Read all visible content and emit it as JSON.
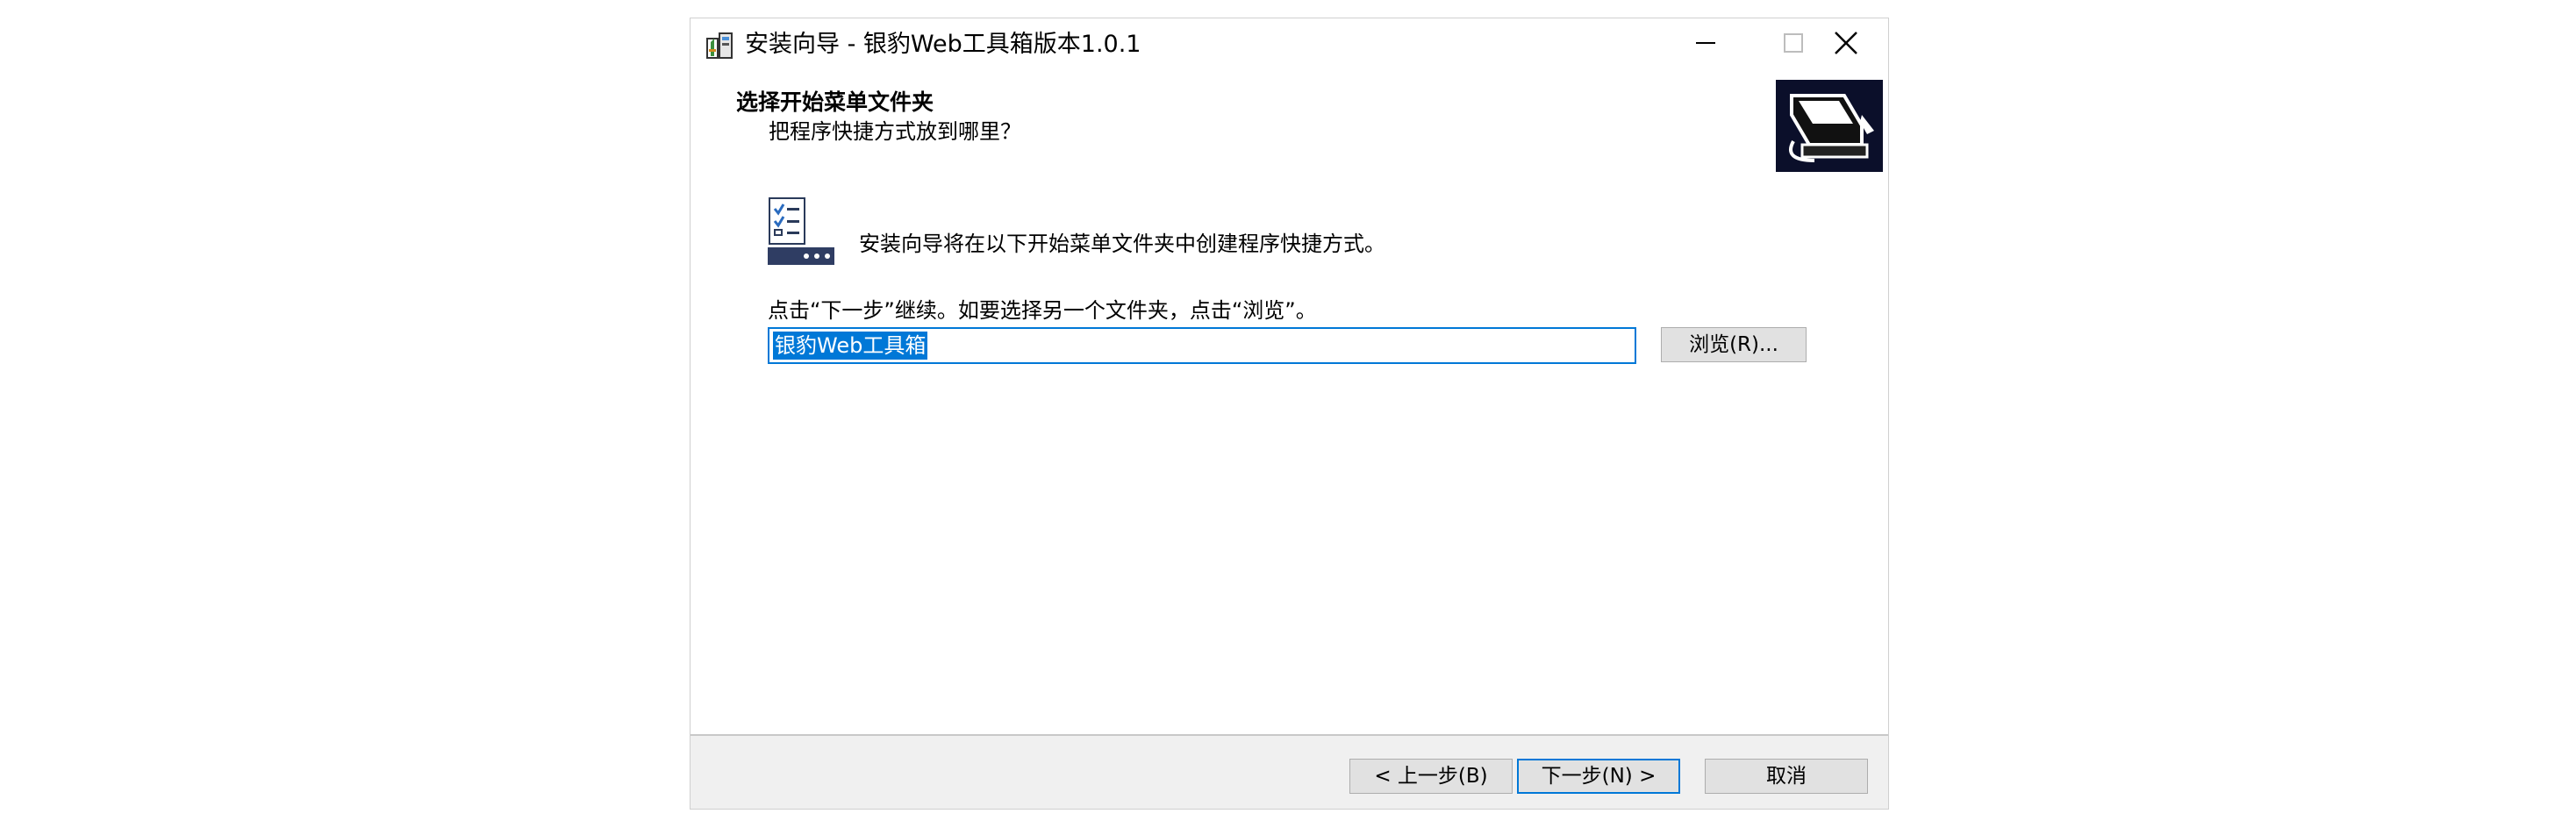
{
  "window": {
    "title": "安装向导 - 银豹Web工具箱版本1.0.1",
    "icon": "installer-icon",
    "controls": [
      "minimize-icon",
      "maximize-icon",
      "close-icon"
    ]
  },
  "header": {
    "title": "选择开始菜单文件夹",
    "subtitle": "把程序快捷方式放到哪里？"
  },
  "body": {
    "info_text": "安装向导将在以下开始菜单文件夹中创建程序快捷方式。",
    "continue_text": "点击“下一步”继续。如要选择另一个文件夹，点击“浏览”。",
    "folder_input_value": "银豹Web工具箱",
    "browse_label": "浏览(R)..."
  },
  "footer": {
    "back_label": "< 上一步(B)",
    "next_label": "下一步(N) >",
    "cancel_label": "取消"
  },
  "colors": {
    "accent": "#0078d7",
    "button_face": "#e1e1e1",
    "footer_bg": "#f0f0f0"
  }
}
